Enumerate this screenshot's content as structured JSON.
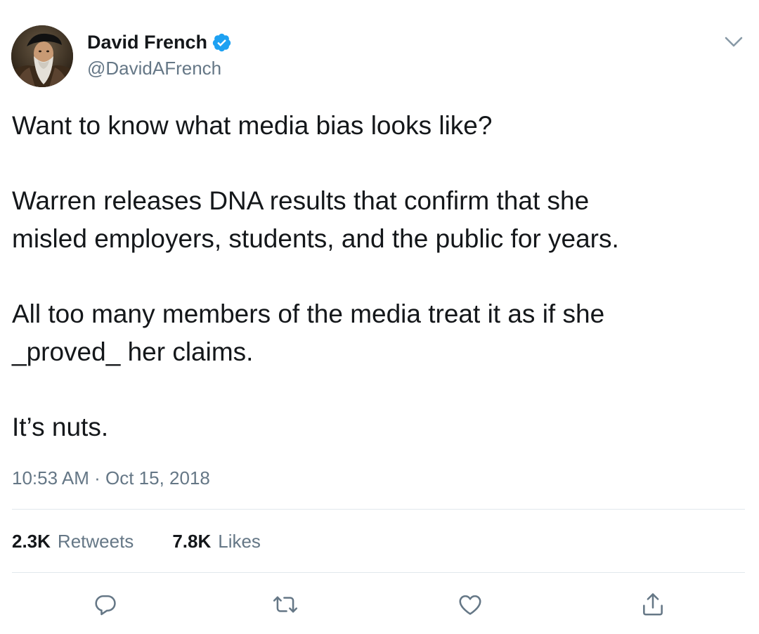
{
  "author": {
    "display_name": "David French",
    "handle": "@DavidAFrench",
    "verified": true
  },
  "tweet": {
    "paragraphs": [
      [
        "Want to know what media bias looks like?"
      ],
      [
        "Warren releases DNA results that confirm that she",
        "misled employers, students, and the public for years."
      ],
      [
        "All too many members of the media treat it as if she",
        "_proved_ her claims."
      ],
      [
        "It’s nuts."
      ]
    ]
  },
  "meta": {
    "time": "10:53 AM",
    "separator": "·",
    "date": "Oct 15, 2018"
  },
  "stats": {
    "retweets_count": "2.3K",
    "retweets_label": "Retweets",
    "likes_count": "7.8K",
    "likes_label": "Likes"
  },
  "icons": {
    "more": "chevron-down-icon",
    "reply": "reply-icon",
    "retweet": "retweet-icon",
    "like": "heart-icon",
    "share": "share-icon",
    "verified": "verified-badge-icon"
  },
  "colors": {
    "text": "#14171a",
    "secondary": "#657786",
    "verified": "#1da1f2",
    "divider": "#e1e8ed"
  }
}
